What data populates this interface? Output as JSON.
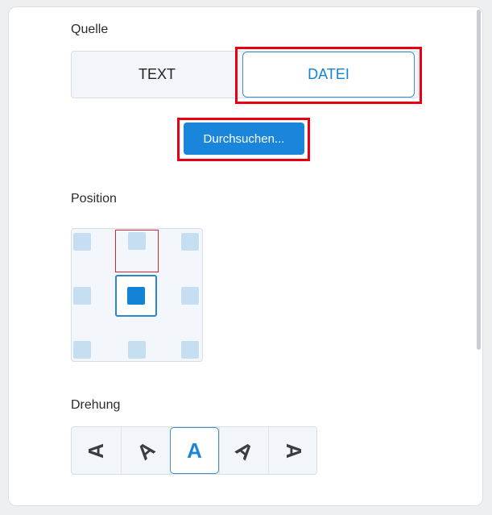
{
  "source": {
    "label": "Quelle",
    "options": [
      "TEXT",
      "DATEI"
    ],
    "selected": "DATEI"
  },
  "browse": {
    "label": "Durchsuchen..."
  },
  "position": {
    "label": "Position",
    "selected_row": 2,
    "selected_col": 2
  },
  "rotation": {
    "label": "Drehung",
    "glyph": "A",
    "selected_index": 2
  },
  "colors": {
    "accent": "#1a86db",
    "highlight": "#e60012"
  }
}
